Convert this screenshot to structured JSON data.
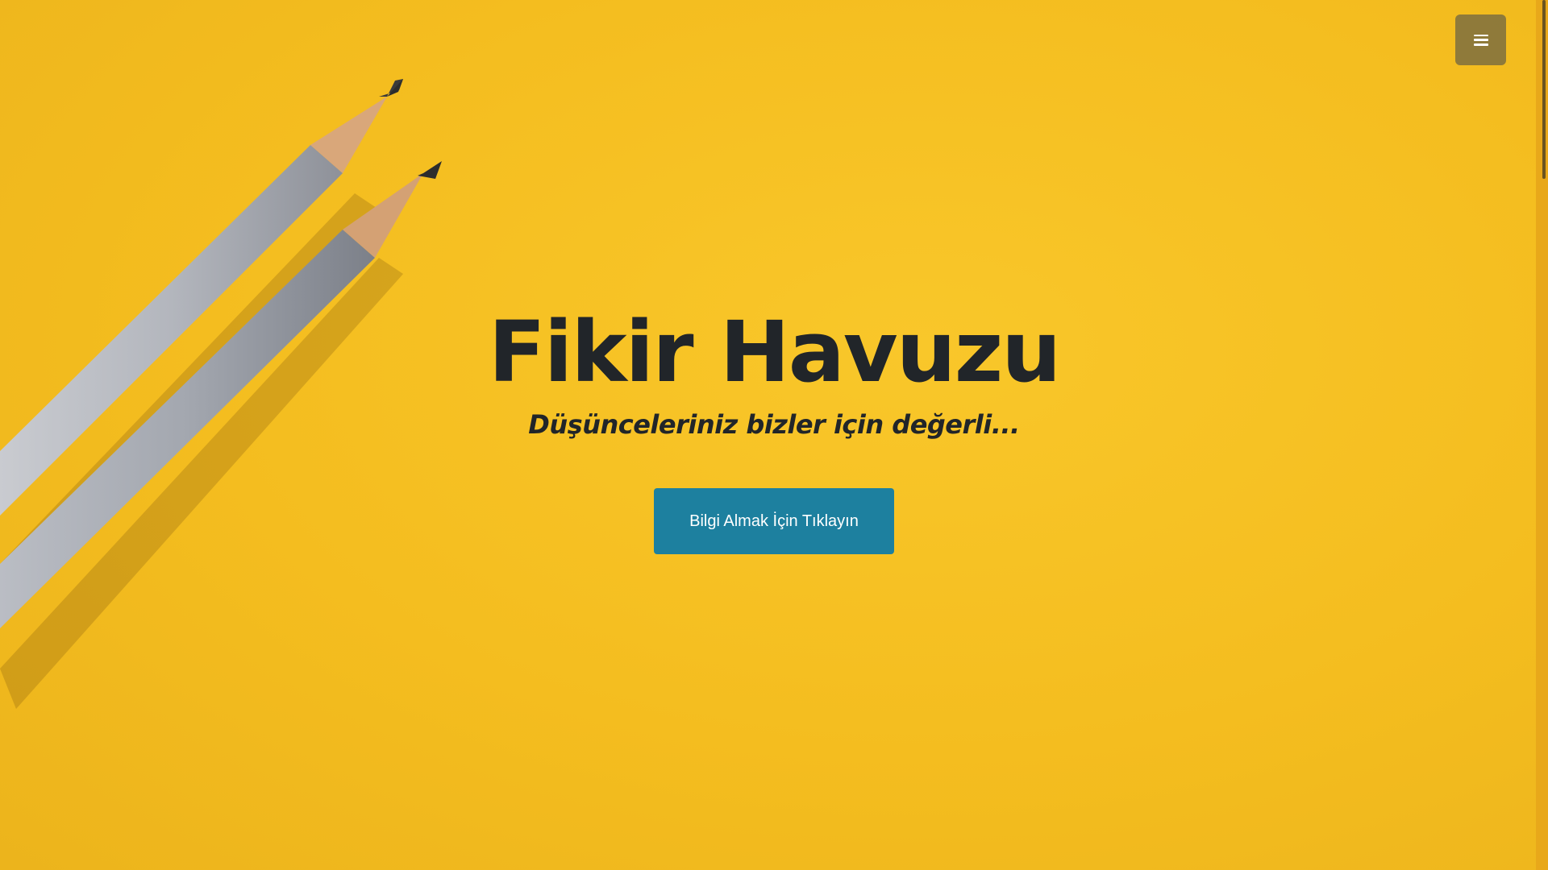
{
  "hero": {
    "title": "Fikir Havuzu",
    "subtitle": "Düşünceleriniz bizler için değerli...",
    "cta_label": "Bilgi Almak İçin Tıklayın"
  },
  "menu": {
    "icon": "hamburger-menu-icon"
  },
  "colors": {
    "background": "#f4bd1f",
    "text": "#212529",
    "cta_background": "#1d809f",
    "cta_text": "#ffffff",
    "menu_background": "#7d6e40"
  }
}
